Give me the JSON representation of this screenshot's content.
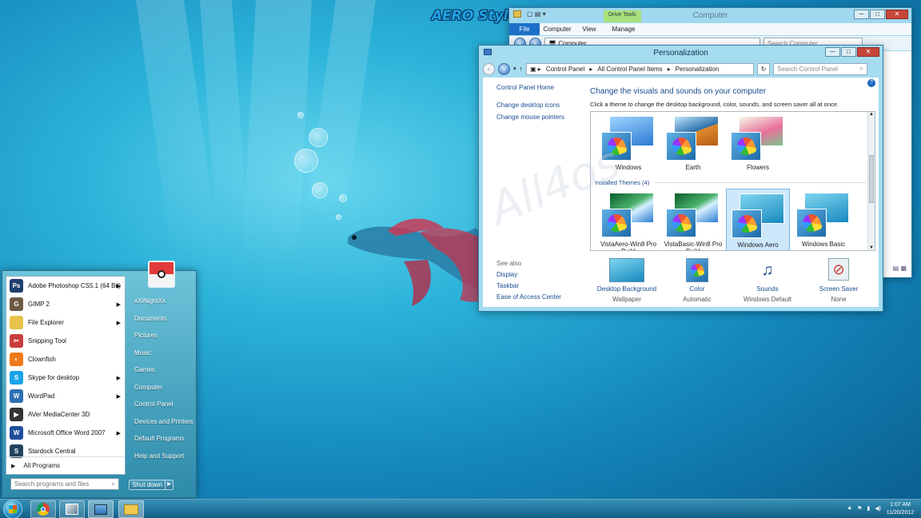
{
  "desktop": {
    "logo_text": "AERO Style",
    "watermark": "All4os"
  },
  "explorer": {
    "title": "Computer",
    "ribbon_context": "Drive Tools",
    "tabs": [
      "File",
      "Computer",
      "View",
      "Manage"
    ],
    "address": "Computer",
    "search_placeholder": "Search Computer"
  },
  "personalization": {
    "title": "Personalization",
    "breadcrumb": [
      "Control Panel",
      "All Control Panel Items",
      "Personalization"
    ],
    "search_placeholder": "Search Control Panel",
    "sidebar": {
      "home": "Control Panel Home",
      "links": [
        "Change desktop icons",
        "Change mouse pointers"
      ],
      "see_also_heading": "See also",
      "see_also": [
        "Display",
        "Taskbar",
        "Ease of Access Center"
      ]
    },
    "heading": "Change the visuals and sounds on your computer",
    "subheading": "Click a theme to change the desktop background, color, sounds, and screen saver all at once.",
    "default_themes": [
      "Windows",
      "Earth",
      "Flowers"
    ],
    "installed_heading": "Installed Themes (4)",
    "installed_themes": [
      "VistaAero-Win8 Pro Build",
      "VistaBasic-Win8 Pro Build",
      "Windows Aero",
      "Windows Basic"
    ],
    "selected_theme": "Windows Aero",
    "settings": [
      {
        "label": "Desktop Background",
        "value": "Wallpaper"
      },
      {
        "label": "Color",
        "value": "Automatic"
      },
      {
        "label": "Sounds",
        "value": "Windows Default"
      },
      {
        "label": "Screen Saver",
        "value": "None"
      }
    ]
  },
  "start_menu": {
    "programs": [
      {
        "label": "Adobe Photoshop CS5.1 (64 Bit)",
        "icon": "photoshop-icon",
        "abbr": "Ps",
        "color": "#1e3f6e",
        "arrow": true
      },
      {
        "label": "GIMP 2",
        "icon": "gimp-icon",
        "abbr": "G",
        "color": "#6d5a45",
        "arrow": true
      },
      {
        "label": "File Explorer",
        "icon": "folder-icon",
        "abbr": "",
        "color": "#e9c24a",
        "arrow": true
      },
      {
        "label": "Snipping Tool",
        "icon": "scissors-icon",
        "abbr": "✂",
        "color": "#c93c3c",
        "arrow": false
      },
      {
        "label": "Clownfish",
        "icon": "clownfish-icon",
        "abbr": "◐",
        "color": "#f07a1a",
        "arrow": false
      },
      {
        "label": "Skype for desktop",
        "icon": "skype-icon",
        "abbr": "S",
        "color": "#1aa3e8",
        "arrow": true
      },
      {
        "label": "WordPad",
        "icon": "wordpad-icon",
        "abbr": "W",
        "color": "#2f6fb3",
        "arrow": true
      },
      {
        "label": "AVer MediaCenter 3D",
        "icon": "aver-icon",
        "abbr": "▶",
        "color": "#333333",
        "arrow": false
      },
      {
        "label": "Microsoft Office Word 2007",
        "icon": "word-icon",
        "abbr": "W",
        "color": "#1f4f9c",
        "arrow": true
      },
      {
        "label": "Stardock Central",
        "icon": "stardock-icon",
        "abbr": "S",
        "color": "#23435e",
        "arrow": false
      }
    ],
    "all_programs": "All Programs",
    "search_placeholder": "Search programs and files",
    "user": "xXiNightXx",
    "right_items": [
      "Documents",
      "Pictures",
      "Music",
      "Games",
      "Computer",
      "Control Panel",
      "Devices and Printers",
      "Default Programs",
      "Help and Support"
    ],
    "shutdown": "Shut down"
  },
  "taskbar": {
    "time": "1:07 AM",
    "date": "11/20/2012"
  }
}
